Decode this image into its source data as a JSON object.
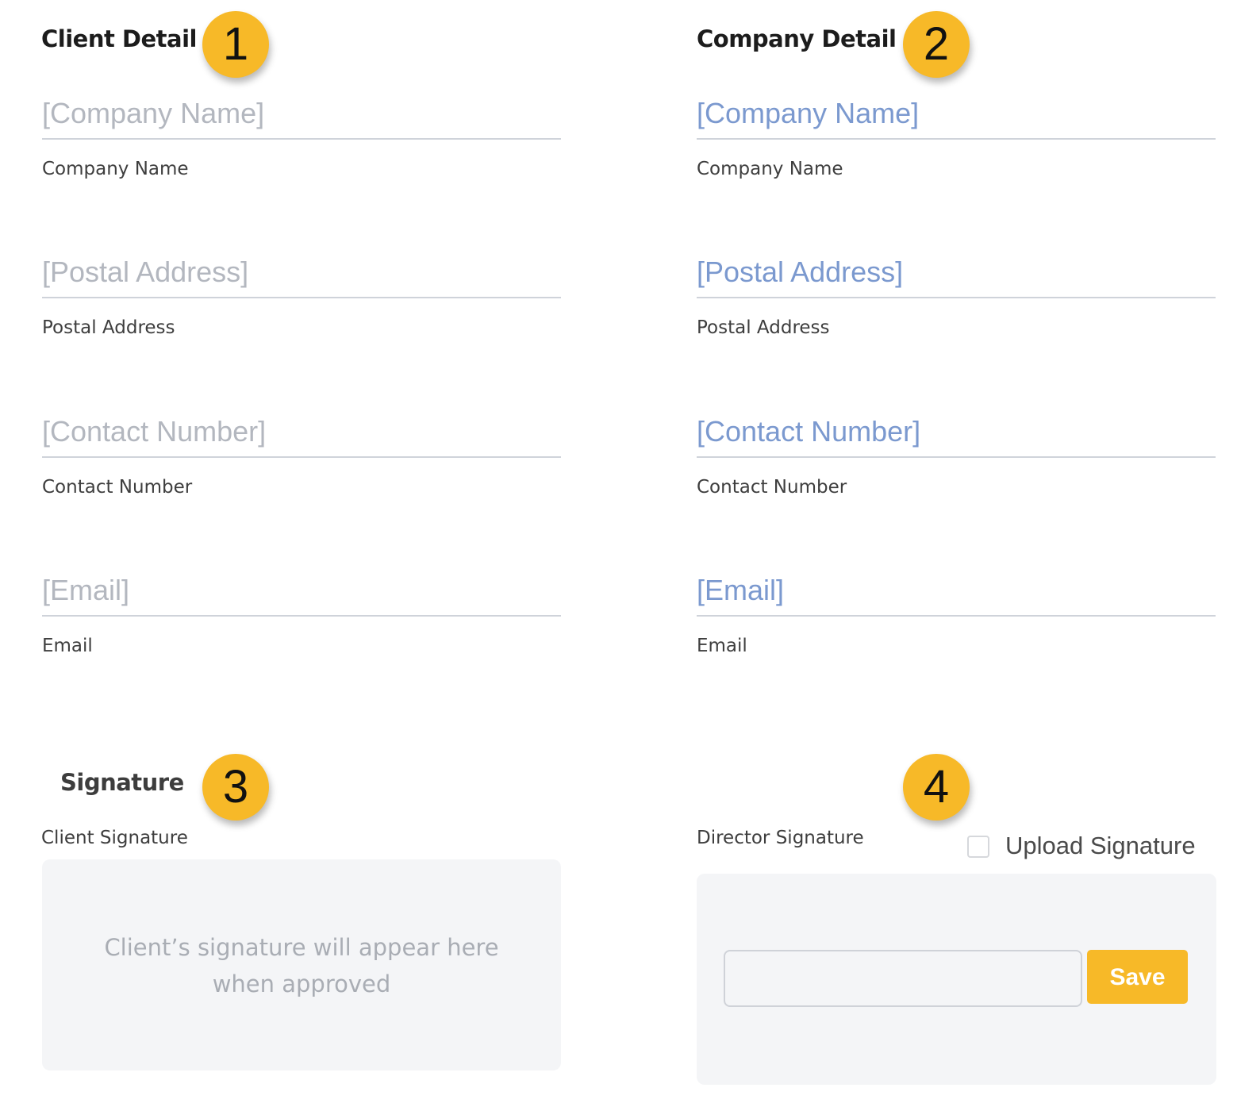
{
  "client_detail": {
    "heading": "Client Detail",
    "badge": "1",
    "fields": [
      {
        "value": "[Company Name]",
        "label": "Company Name"
      },
      {
        "value": "[Postal Address]",
        "label": "Postal Address"
      },
      {
        "value": "[Contact Number]",
        "label": "Contact Number"
      },
      {
        "value": "[Email]",
        "label": "Email"
      }
    ]
  },
  "company_detail": {
    "heading": "Company Detail",
    "badge": "2",
    "fields": [
      {
        "value": "[Company Name]",
        "label": "Company Name"
      },
      {
        "value": "[Postal Address]",
        "label": "Postal Address"
      },
      {
        "value": "[Contact Number]",
        "label": "Contact Number"
      },
      {
        "value": "[Email]",
        "label": "Email"
      }
    ]
  },
  "signature": {
    "heading": "Signature",
    "badge": "3",
    "client_label": "Client Signature",
    "client_placeholder_line1": "Client’s signature will appear here",
    "client_placeholder_line2": "when approved"
  },
  "director": {
    "badge": "4",
    "label": "Director Signature",
    "upload_label": "Upload Signature",
    "upload_checked": false,
    "signature_input_value": "",
    "save_label": "Save"
  },
  "colors": {
    "accent": "#f7b928",
    "client_field_text": "#b3b7bf",
    "company_field_text": "#7b99cf",
    "box_bg": "#f4f5f7"
  }
}
